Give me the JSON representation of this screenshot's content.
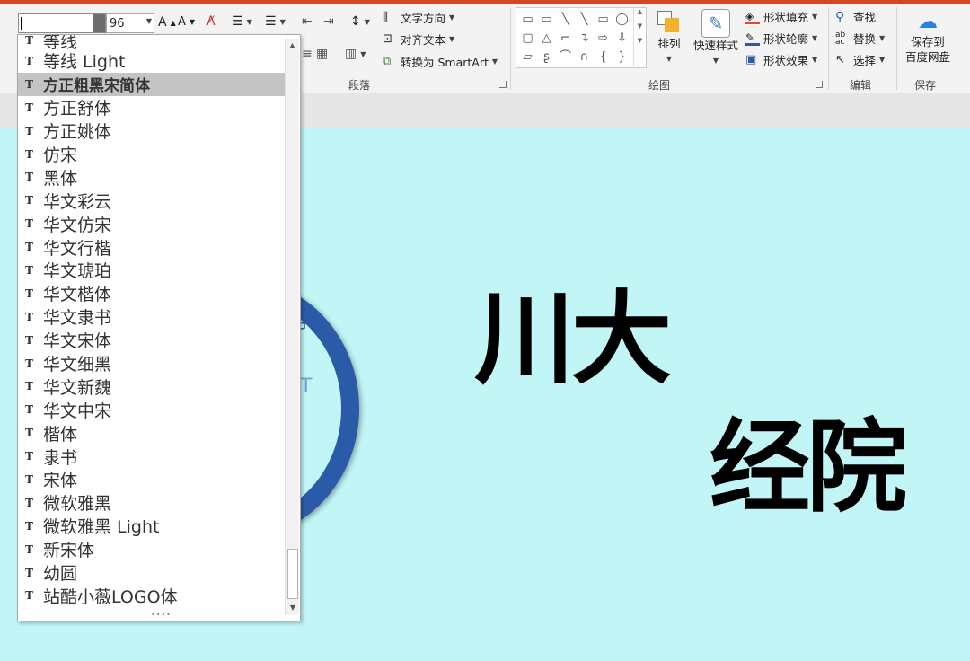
{
  "ribbon": {
    "font_size_value": "96",
    "paragraph": {
      "text_direction": "文字方向",
      "align_text": "对齐文本",
      "convert_smartart": "转换为 SmartArt",
      "group_label": "段落"
    },
    "drawing": {
      "arrange": "排列",
      "quick_styles": "快速样式",
      "shape_fill": "形状填充",
      "shape_outline": "形状轮廓",
      "shape_effects": "形状效果",
      "group_label": "绘图"
    },
    "editing": {
      "find": "查找",
      "replace": "替换",
      "select": "选择",
      "group_label": "编辑"
    },
    "save": {
      "save_to_cloud_line1": "保存到",
      "save_to_cloud_line2": "百度网盘",
      "group_label": "保存"
    },
    "shapes": [
      "▭",
      "▭",
      "╲",
      "╲",
      "▭",
      "◯",
      "▢",
      "△",
      "⌐",
      "↴",
      "⇨",
      "⇩",
      "▱",
      "ʂ",
      "⌒",
      "∩",
      "{",
      "}"
    ]
  },
  "slide": {
    "title_line1": "川大",
    "title_line2": "经院",
    "logo_text_1": "学",
    "logo_text_2": "T"
  },
  "font_dropdown": {
    "selected_index": 2,
    "items": [
      "等线",
      "等线 Light",
      "方正粗黑宋简体",
      "方正舒体",
      "方正姚体",
      "仿宋",
      "黑体",
      "华文彩云",
      "华文仿宋",
      "华文行楷",
      "华文琥珀",
      "华文楷体",
      "华文隶书",
      "华文宋体",
      "华文细黑",
      "华文新魏",
      "华文中宋",
      "楷体",
      "隶书",
      "宋体",
      "微软雅黑",
      "微软雅黑 Light",
      "新宋体",
      "幼圆",
      "站酷小薇LOGO体"
    ]
  }
}
